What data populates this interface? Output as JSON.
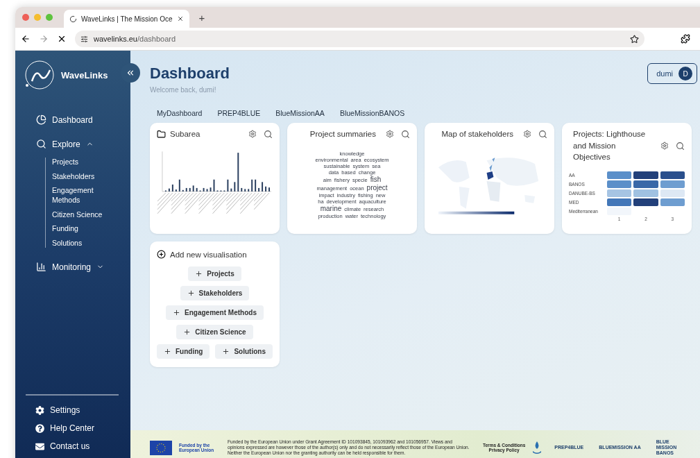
{
  "browser": {
    "tab_title": "WaveLinks | The Mission Oce",
    "new_tab": "+",
    "url_host": "wavelinks.eu",
    "url_path": "/dashboard"
  },
  "sidebar": {
    "brand": "WaveLinks",
    "nav": [
      {
        "label": "Dashboard"
      },
      {
        "label": "Explore",
        "expanded": true,
        "children": [
          "Projects",
          "Stakeholders",
          "Engagement Methods",
          "Citizen Science",
          "Funding",
          "Solutions"
        ]
      },
      {
        "label": "Monitoring",
        "expanded": false
      }
    ],
    "footer_items": [
      "Settings",
      "Help Center",
      "Contact us"
    ]
  },
  "header": {
    "title": "Dashboard",
    "subtitle": "Welcome back, dumi!",
    "user": {
      "name": "dumi",
      "initial": "D"
    }
  },
  "dashboard_tabs": [
    "MyDashboard",
    "PREP4BLUE",
    "BlueMissionAA",
    "BlueMissionBANOS"
  ],
  "cards": [
    {
      "kind": "bar",
      "title": "Subarea"
    },
    {
      "kind": "wordcloud",
      "title": "Project summaries",
      "lines": [
        [
          {
            "text": "knowledge",
            "large": false
          }
        ],
        [
          {
            "text": "environmental",
            "large": false
          },
          {
            "text": "area",
            "large": false
          },
          {
            "text": "ecosystem",
            "large": false
          }
        ],
        [
          {
            "text": "sustainable",
            "large": false
          },
          {
            "text": "system",
            "large": false
          },
          {
            "text": "sea",
            "large": false
          }
        ],
        [
          {
            "text": "data",
            "large": false
          },
          {
            "text": "based",
            "large": false
          },
          {
            "text": "change",
            "large": false
          }
        ],
        [
          {
            "text": "aim",
            "large": false
          },
          {
            "text": "fishery",
            "large": false
          },
          {
            "text": "specie",
            "large": false
          },
          {
            "text": "fish",
            "large": true
          }
        ],
        [
          {
            "text": "management",
            "large": false
          },
          {
            "text": "ocean",
            "large": false
          },
          {
            "text": "project",
            "large": true
          }
        ],
        [
          {
            "text": "impact",
            "large": false
          },
          {
            "text": "industry",
            "large": false
          },
          {
            "text": "fishing",
            "large": false
          },
          {
            "text": "new",
            "large": false
          }
        ],
        [
          {
            "text": "ha",
            "large": false
          },
          {
            "text": "development",
            "large": false
          },
          {
            "text": "aquaculture",
            "large": false
          }
        ],
        [
          {
            "text": "marine",
            "large": true
          },
          {
            "text": "climate",
            "large": false
          },
          {
            "text": "research",
            "large": false
          }
        ],
        [
          {
            "text": "production",
            "large": false
          },
          {
            "text": "water",
            "large": false
          },
          {
            "text": "technology",
            "large": false
          }
        ]
      ]
    },
    {
      "kind": "map",
      "title": "Map of stakeholders"
    },
    {
      "kind": "heatmap",
      "title": "Projects: Lighthouse and Mission Objectives",
      "columns": [
        "1",
        "2",
        "3"
      ],
      "rows": [
        {
          "label": "AA",
          "cells": [
            {
              "color": "#5b8fc9"
            },
            {
              "color": "#22407a"
            },
            {
              "color": "#2a4f8c"
            }
          ]
        },
        {
          "label": "BANOS",
          "cells": [
            {
              "color": "#5b8fc9"
            },
            {
              "color": "#3a68a8"
            },
            {
              "color": "#6e9dd0"
            }
          ]
        },
        {
          "label": "DANUBE-BS",
          "cells": [
            {
              "color": "#a6c4e3"
            },
            {
              "color": "#a0c1e1"
            },
            {
              "color": "#dde8f4"
            }
          ]
        },
        {
          "label": "MED",
          "cells": [
            {
              "color": "#4377b8"
            },
            {
              "color": "#22407a"
            },
            {
              "color": "#6e9dd0"
            }
          ]
        },
        {
          "label": "Mediterranean",
          "cells": [
            {
              "color": "#f2f6fb"
            }
          ]
        }
      ]
    }
  ],
  "add_card": {
    "title": "Add new visualisation",
    "option_rows": [
      [
        "Projects"
      ],
      [
        "Stakeholders"
      ],
      [
        "Engagement Methods"
      ],
      [
        "Citizen Science"
      ],
      [
        "Funding",
        "Solutions"
      ]
    ]
  },
  "footer": {
    "eu_label": "Funded by the European Union",
    "disclaimer": "Funded by the European Union under Grant Agreement ID 101093845, 101093962 and 101056957. Views and opinions expressed are however those of the author(s) only and do not necessarily reflect those of the European Union. Neither the European Union nor the granting authority can be held responsible for them.",
    "links": [
      "Terms & Conditions",
      "Privacy Policy"
    ],
    "partners": [
      "PREP4BLUE",
      "BLUEMISSION AA",
      "BLUE MISSION BANOS"
    ]
  }
}
